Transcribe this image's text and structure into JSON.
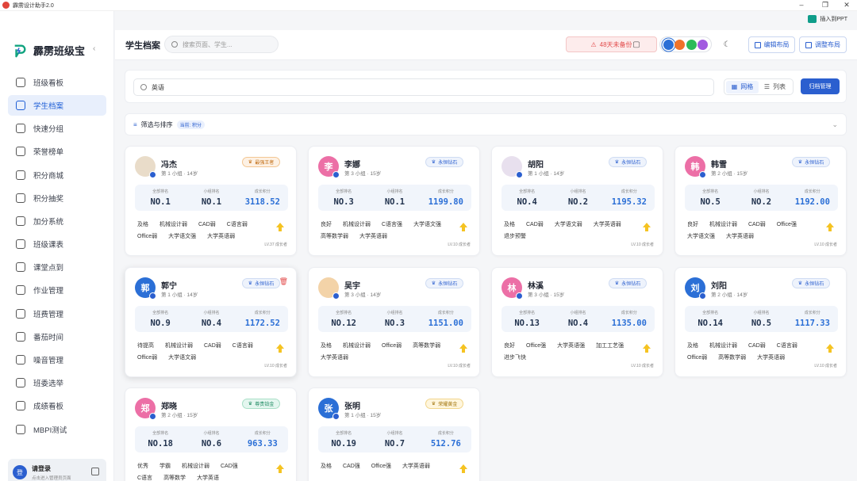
{
  "app": {
    "title": "霹雳设计助手2.0",
    "insert_ppt": "插入到PPT",
    "brand": "霹雳班级宝"
  },
  "sidebar": {
    "items": [
      {
        "label": "班级看板",
        "icon": "chart-icon"
      },
      {
        "label": "学生档案",
        "icon": "users-icon",
        "active": true
      },
      {
        "label": "快速分组",
        "icon": "group-icon"
      },
      {
        "label": "荣誉榜单",
        "icon": "trophy-icon"
      },
      {
        "label": "积分商城",
        "icon": "store-icon"
      },
      {
        "label": "积分抽奖",
        "icon": "gift-icon"
      },
      {
        "label": "加分系统",
        "icon": "plus-icon"
      },
      {
        "label": "班级课表",
        "icon": "calendar-icon"
      },
      {
        "label": "课堂点到",
        "icon": "check-icon"
      },
      {
        "label": "作业管理",
        "icon": "homework-icon"
      },
      {
        "label": "班费管理",
        "icon": "wallet-icon"
      },
      {
        "label": "番茄时间",
        "icon": "timer-icon"
      },
      {
        "label": "噪音管理",
        "icon": "sound-icon"
      },
      {
        "label": "班委选举",
        "icon": "vote-icon"
      },
      {
        "label": "成绩看板",
        "icon": "grade-icon"
      },
      {
        "label": "MBPI测试",
        "icon": "test-icon"
      }
    ],
    "login": {
      "avatar": "登",
      "title": "请登录",
      "subtitle": "点击进入管理员页面"
    }
  },
  "header": {
    "title": "学生档案",
    "search_placeholder": "搜索页面、学生...",
    "backup_warning": "48天未备份",
    "edit_layout": "编辑布局",
    "adjust_layout": "调整布局",
    "theme_colors": [
      "#2b6fd6",
      "#f0732a",
      "#2dbb5a",
      "#a25be0"
    ]
  },
  "toolbar": {
    "search_value": "英语",
    "grid_label": "网格",
    "list_label": "列表",
    "archive_button": "归档管理"
  },
  "filter": {
    "label": "筛选与排序",
    "badge": "当前: 积分"
  },
  "stat_labels": {
    "all_rank": "全部排名",
    "group_rank": "小组排名",
    "points": "成长积分"
  },
  "students": [
    {
      "name": "冯杰",
      "avatar": "",
      "avatar_color": "#e9dcc9",
      "sub": "第 1 小组 · 14岁",
      "badge": "最强王者",
      "badge_type": "king",
      "all_rank": "NO.1",
      "group_rank": "NO.1",
      "points": "3118.52",
      "tags": [
        "及格",
        "机械设计弱",
        "CAD弱",
        "C语言弱",
        "Office弱",
        "大学语文强",
        "大学英语弱"
      ],
      "level": "LV.37 成长者"
    },
    {
      "name": "李娜",
      "avatar": "李",
      "avatar_color": "#ec6fa6",
      "sub": "第 3 小组 · 15岁",
      "badge": "永恒钻石",
      "badge_type": "diamond",
      "all_rank": "NO.3",
      "group_rank": "NO.1",
      "points": "1199.80",
      "tags": [
        "良好",
        "机械设计弱",
        "C语言强",
        "大学语文强",
        "高等数学弱",
        "大学英语弱"
      ],
      "level": "LV.10 成长者"
    },
    {
      "name": "胡阳",
      "avatar": "",
      "avatar_color": "#e8e0ee",
      "sub": "第 1 小组 · 14岁",
      "badge": "永恒钻石",
      "badge_type": "diamond",
      "all_rank": "NO.4",
      "group_rank": "NO.2",
      "points": "1195.32",
      "tags": [
        "及格",
        "CAD弱",
        "大学语文弱",
        "大学英语弱",
        "退步预警"
      ],
      "level": "LV.10 成长者"
    },
    {
      "name": "韩雪",
      "avatar": "韩",
      "avatar_color": "#ec6fa6",
      "sub": "第 2 小组 · 15岁",
      "badge": "永恒钻石",
      "badge_type": "diamond",
      "all_rank": "NO.5",
      "group_rank": "NO.2",
      "points": "1192.00",
      "tags": [
        "良好",
        "机械设计弱",
        "CAD弱",
        "Office强",
        "大学语文强",
        "大学英语弱"
      ],
      "level": "LV.10 成长者"
    },
    {
      "name": "郭宁",
      "avatar": "郭",
      "avatar_color": "#2b6fd6",
      "sub": "第 1 小组 · 14岁",
      "badge": "永恒钻石",
      "badge_type": "diamond",
      "all_rank": "NO.9",
      "group_rank": "NO.4",
      "points": "1172.52",
      "tags": [
        "待提高",
        "机械设计弱",
        "CAD弱",
        "C语言弱",
        "Office弱",
        "大学语文弱"
      ],
      "level": "LV.10 成长者",
      "selected": true
    },
    {
      "name": "吴宇",
      "avatar": "",
      "avatar_color": "#f3d3a8",
      "sub": "第 3 小组 · 14岁",
      "badge": "永恒钻石",
      "badge_type": "diamond",
      "all_rank": "NO.12",
      "group_rank": "NO.3",
      "points": "1151.00",
      "tags": [
        "及格",
        "机械设计弱",
        "Office弱",
        "高等数学弱",
        "大学英语弱"
      ],
      "level": "LV.10 成长者"
    },
    {
      "name": "林溪",
      "avatar": "林",
      "avatar_color": "#ec6fa6",
      "sub": "第 3 小组 · 15岁",
      "badge": "永恒钻石",
      "badge_type": "diamond",
      "all_rank": "NO.13",
      "group_rank": "NO.4",
      "points": "1135.00",
      "tags": [
        "良好",
        "Office强",
        "大学英语强",
        "加工工艺强",
        "进步飞快"
      ],
      "level": "LV.10 成长者"
    },
    {
      "name": "刘阳",
      "avatar": "刘",
      "avatar_color": "#2b6fd6",
      "sub": "第 2 小组 · 14岁",
      "badge": "永恒钻石",
      "badge_type": "diamond",
      "all_rank": "NO.14",
      "group_rank": "NO.5",
      "points": "1117.33",
      "tags": [
        "及格",
        "机械设计弱",
        "CAD弱",
        "C语言弱",
        "Office弱",
        "高等数学弱",
        "大学英语弱"
      ],
      "level": "LV.10 成长者"
    },
    {
      "name": "郑晓",
      "avatar": "郑",
      "avatar_color": "#ec6fa6",
      "sub": "第 2 小组 · 15岁",
      "badge": "尊贵铂金",
      "badge_type": "platinum",
      "all_rank": "NO.18",
      "group_rank": "NO.6",
      "points": "963.33",
      "tags": [
        "优秀",
        "学霸",
        "机械设计弱",
        "CAD强",
        "C语言",
        "高等数学",
        "大学英语"
      ],
      "level": ""
    },
    {
      "name": "张明",
      "avatar": "张",
      "avatar_color": "#2b6fd6",
      "sub": "第 1 小组 · 15岁",
      "badge": "荣耀黄金",
      "badge_type": "gold",
      "all_rank": "NO.19",
      "group_rank": "NO.7",
      "points": "512.76",
      "tags": [
        "及格",
        "CAD强",
        "Office强",
        "大学英语弱"
      ],
      "level": ""
    }
  ]
}
